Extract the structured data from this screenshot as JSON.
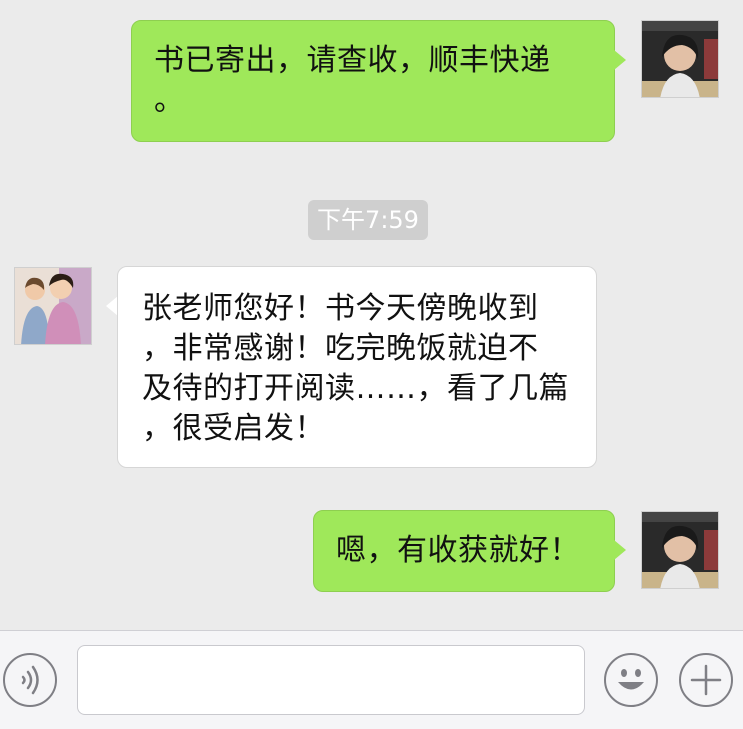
{
  "conversation": {
    "messages": [
      {
        "text": "书已寄出，请查收，顺丰快递\n。"
      },
      {
        "text": "张老师您好！书今天傍晚收到\n，非常感谢！吃完晚饭就迫不\n及待的打开阅读……，看了几篇\n，很受启发！"
      },
      {
        "text": "嗯，有收获就好！"
      }
    ],
    "time_badge": "下午7:59"
  },
  "input_bar": {
    "message_value": ""
  },
  "colors": {
    "outgoing_bubble": "#9fe85a",
    "incoming_bubble": "#ffffff",
    "background": "#ebebeb",
    "time_badge": "#cfcfcf"
  },
  "icons": {
    "voice": "voice-icon",
    "emoji": "emoji-icon",
    "add": "add-icon"
  }
}
